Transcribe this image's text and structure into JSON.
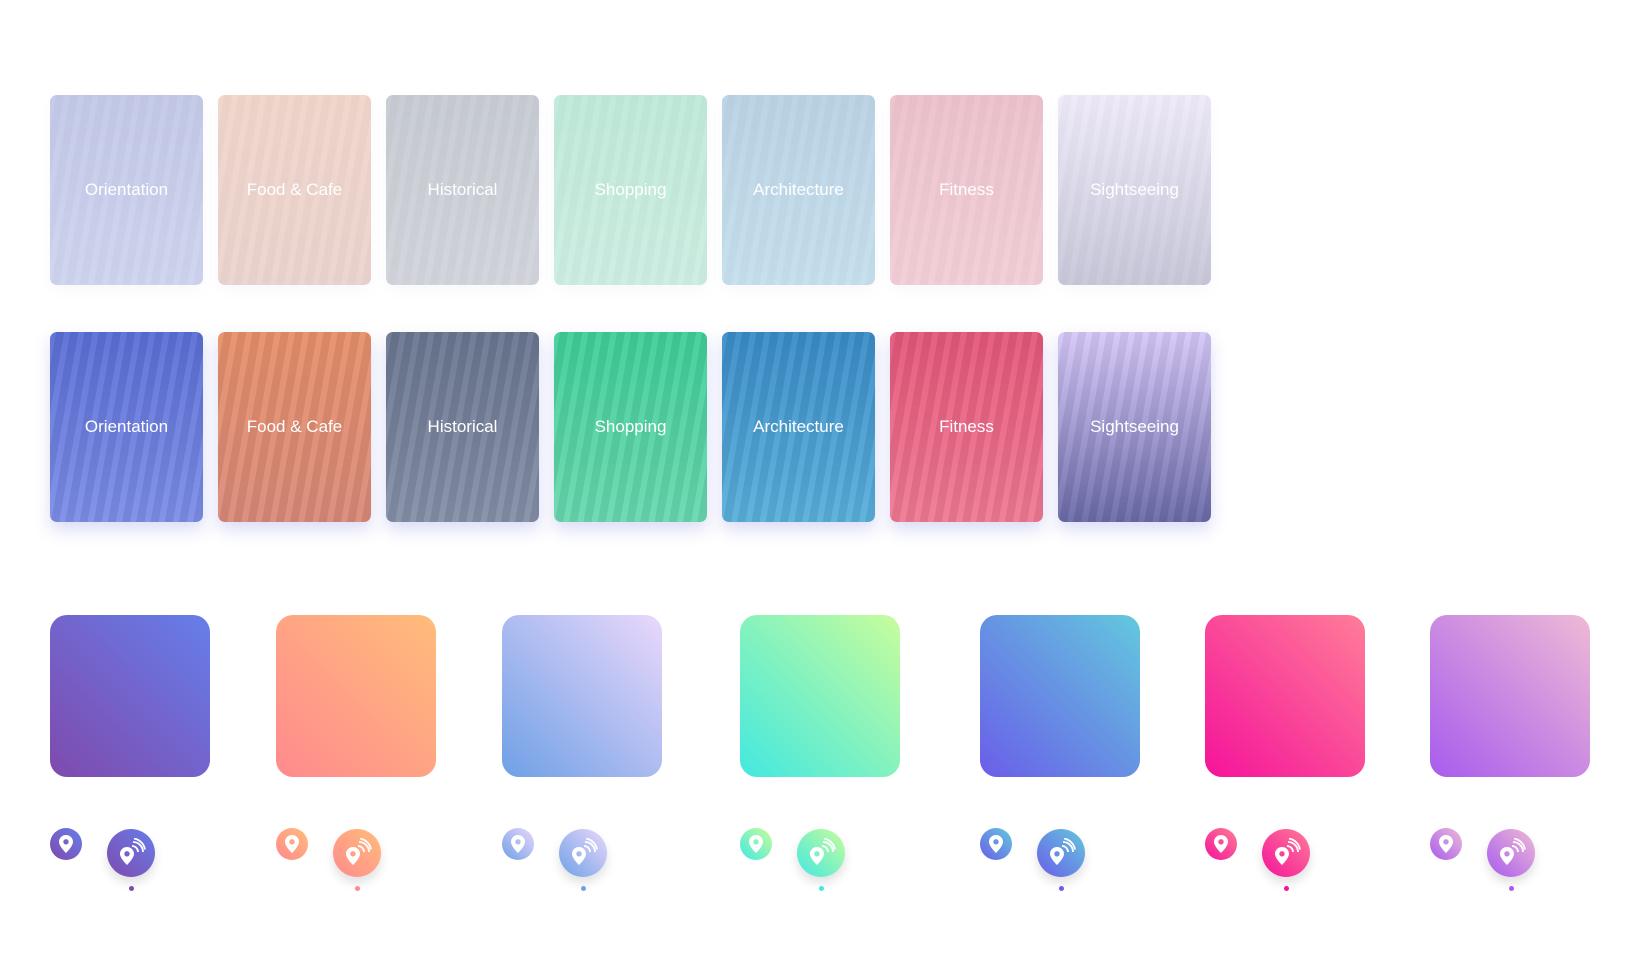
{
  "categories_faded": [
    "Orientation",
    "Food & Cafe",
    "Historical",
    "Shopping",
    "Architecture",
    "Fitness",
    "Sightseeing"
  ],
  "categories": [
    "Orientation",
    "Food & Cafe",
    "Historical",
    "Shopping",
    "Architecture",
    "Fitness",
    "Sightseeing"
  ],
  "card_colors": [
    [
      "#5b6fd6",
      "#7d8ee8"
    ],
    [
      "#e7906a",
      "#d98a7a"
    ],
    [
      "#6a7690",
      "#8590a8"
    ],
    [
      "#3fcf98",
      "#6ad8b0"
    ],
    [
      "#3a8cc8",
      "#5ab0dc"
    ],
    [
      "#e5577a",
      "#f07a94"
    ],
    [
      "#d6c8f8",
      "#6a6aa8"
    ]
  ],
  "swatches": [
    {
      "from": "#7f4aad",
      "to": "#667eea"
    },
    {
      "from": "#ff8a8e",
      "to": "#ffbd7a"
    },
    {
      "from": "#6fa0e6",
      "to": "#ead8fb"
    },
    {
      "from": "#43e8e0",
      "to": "#c8fd9c"
    },
    {
      "from": "#6a5ee8",
      "to": "#63c8de"
    },
    {
      "from": "#f5139a",
      "to": "#ff7d98"
    },
    {
      "from": "#a85ced",
      "to": "#eebad6"
    }
  ],
  "icons": {
    "small": "map-pin-icon",
    "big": "pin-broadcast-icon"
  }
}
